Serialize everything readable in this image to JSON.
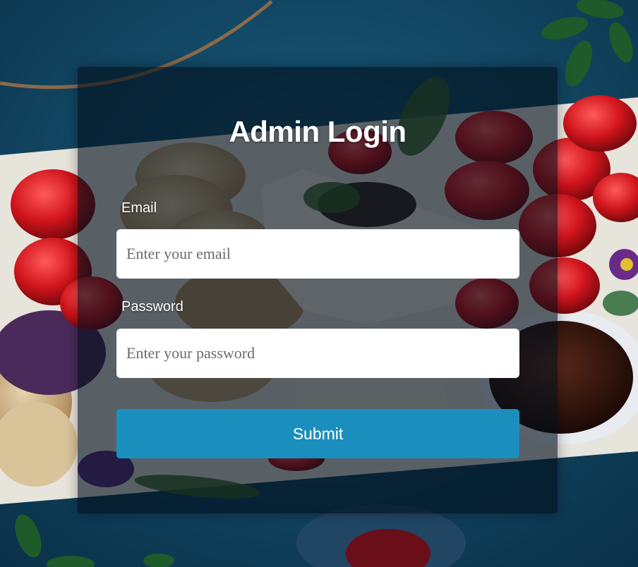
{
  "form": {
    "title": "Admin Login",
    "email_label": "Email",
    "email_placeholder": "Enter your email",
    "password_label": "Password",
    "password_placeholder": "Enter your password",
    "submit_label": "Submit"
  },
  "colors": {
    "background_table": "#0d3f5a",
    "panel_overlay": "rgba(2,15,28,0.62)",
    "button": "#1a8fbd",
    "input_background": "#ffffff",
    "text": "#ffffff"
  },
  "background_icons": [
    "food-board-photo",
    "strawberry-icon",
    "cracker-icon",
    "cheese-icon",
    "jam-bowl-icon",
    "leaf-icon",
    "glass-icon"
  ]
}
